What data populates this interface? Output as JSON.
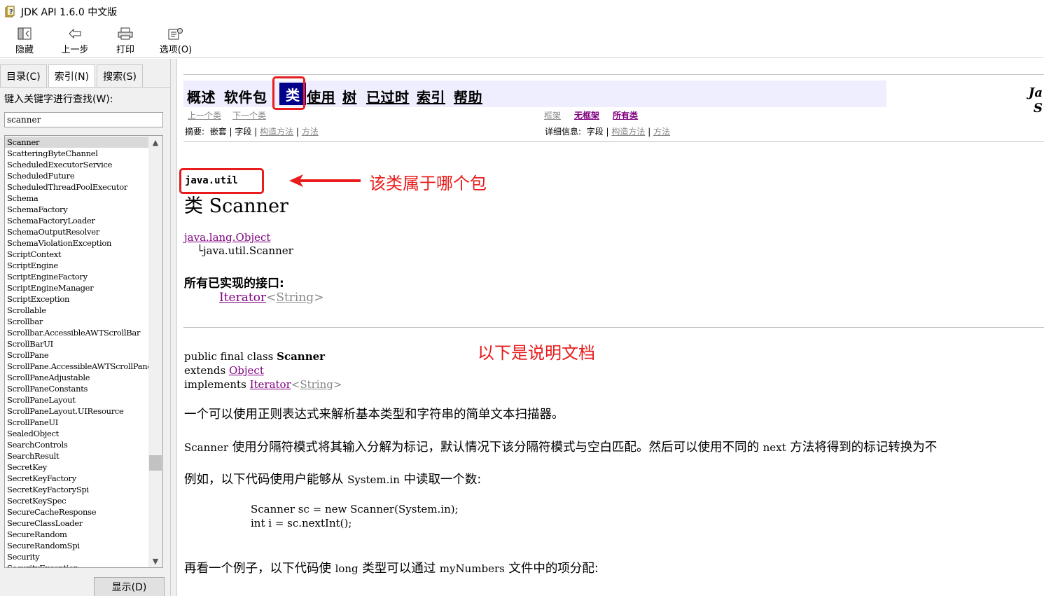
{
  "window": {
    "title": "JDK API 1.6.0 中文版",
    "icon": "help-book-icon"
  },
  "toolbar": {
    "hide": "隐藏",
    "back": "上一步",
    "print": "打印",
    "options": "选项(O)"
  },
  "left": {
    "tabs": [
      "目录(C)",
      "索引(N)",
      "搜索(S)"
    ],
    "keyword_label": "键入关键字进行查找(W):",
    "keyword_value": "scanner",
    "items": [
      "Scanner",
      "ScatteringByteChannel",
      "ScheduledExecutorService",
      "ScheduledFuture",
      "ScheduledThreadPoolExecutor",
      "Schema",
      "SchemaFactory",
      "SchemaFactoryLoader",
      "SchemaOutputResolver",
      "SchemaViolationException",
      "ScriptContext",
      "ScriptEngine",
      "ScriptEngineFactory",
      "ScriptEngineManager",
      "ScriptException",
      "Scrollable",
      "Scrollbar",
      "Scrollbar.AccessibleAWTScrollBar",
      "ScrollBarUI",
      "ScrollPane",
      "ScrollPane.AccessibleAWTScrollPane",
      "ScrollPaneAdjustable",
      "ScrollPaneConstants",
      "ScrollPaneLayout",
      "ScrollPaneLayout.UIResource",
      "ScrollPaneUI",
      "SealedObject",
      "SearchControls",
      "SearchResult",
      "SecretKey",
      "SecretKeyFactory",
      "SecretKeyFactorySpi",
      "SecretKeySpec",
      "SecureCacheResponse",
      "SecureClassLoader",
      "SecureRandom",
      "SecureRandomSpi",
      "Security",
      "SecurityException"
    ],
    "show_button": "显示(D)"
  },
  "doc": {
    "nav": {
      "overview": "概述",
      "package": "软件包",
      "class": "类",
      "use": "使用",
      "tree": "树",
      "deprecated": "已过时",
      "index": "索引",
      "help": "帮助"
    },
    "prev_class": "上一个类",
    "next_class": "下一个类",
    "frames": "框架",
    "no_frames": "无框架",
    "all_classes": "所有类",
    "summary_label": "摘要:",
    "summary_nested": "嵌套",
    "summary_field": "字段",
    "summary_ctor": "构造方法",
    "summary_method": "方法",
    "detail_label": "详细信息:",
    "detail_field": "字段",
    "detail_ctor": "构造方法",
    "detail_method": "方法",
    "right_edge_1": "Ja",
    "right_edge_2": "S",
    "package_name": "java.util",
    "class_title": "类 Scanner",
    "hier_parent": "java.lang.Object",
    "hier_child": "└java.util.Scanner",
    "interfaces_heading": "所有已实现的接口:",
    "iface_name": "Iterator",
    "iface_generic": "String",
    "decl_1a": "public final class ",
    "decl_1b": "Scanner",
    "decl_2a": "extends ",
    "decl_2b": "Object",
    "decl_3a": "implements ",
    "decl_3b": "Iterator",
    "decl_3c": "String",
    "para1": "一个可以使用正则表达式来解析基本类型和字符串的简单文本扫描器。",
    "para2_code1": "Scanner",
    "para2_text1": " 使用分隔符模式将其输入分解为标记，默认情况下该分隔符模式与空白匹配。然后可以使用不同的 ",
    "para2_code2": "next",
    "para2_text2": " 方法将得到的标记转换为不",
    "para3_text1": "例如，以下代码使用户能够从 ",
    "para3_code": "System.in",
    "para3_text2": " 中读取一个数:",
    "code_line1": "Scanner sc = new Scanner(System.in);",
    "code_line2": "int i = sc.nextInt();",
    "para4_text1": "再看一个例子，以下代码使 ",
    "para4_code1": "long",
    "para4_text2": " 类型可以通过 ",
    "para4_code2": "myNumbers",
    "para4_text3": " 文件中的项分配:",
    "annot_package": "该类属于哪个包",
    "annot_doc": "以下是说明文档"
  },
  "colors": {
    "annotation": "#e81c1c",
    "nav_bg": "#eeeeff",
    "nav_current": "#00008b",
    "link": "#800080"
  }
}
